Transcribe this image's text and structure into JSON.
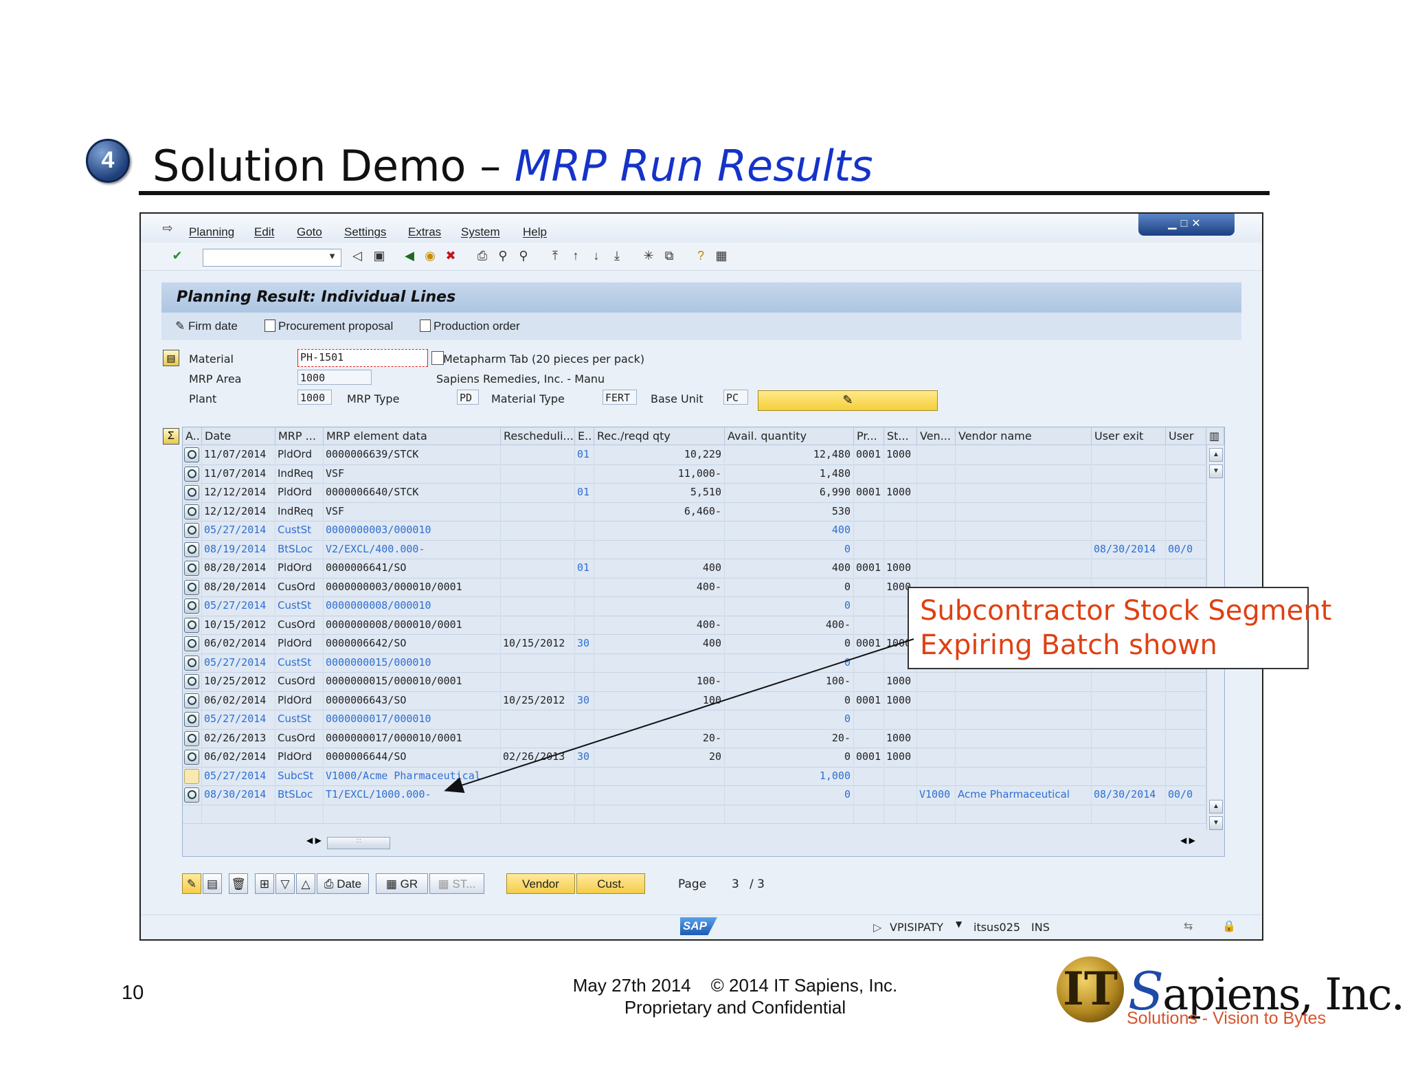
{
  "slide": {
    "step_number": "4",
    "title_main": "Solution Demo – ",
    "title_sub": "MRP Run Results",
    "page_number": "10",
    "footer_line1": "May 27th 2014    © 2014 IT Sapiens, Inc.",
    "footer_line2": "Proprietary and Confidential",
    "logo_mark": "IT",
    "logo_s": "S",
    "logo_rest": "apiens, Inc.",
    "logo_tagline": "Solutions - Vision to Bytes"
  },
  "callout": {
    "line1": "Subcontractor Stock Segment",
    "line2": "Expiring Batch shown",
    "color": "#e04012"
  },
  "sap": {
    "menu": [
      "Planning",
      "Edit",
      "Goto",
      "Settings",
      "Extras",
      "System",
      "Help"
    ],
    "screen_title": "Planning Result: Individual Lines",
    "app_toolbar": [
      "Firm date",
      "Procurement proposal",
      "Production order"
    ],
    "header_fields": {
      "material_label": "Material",
      "material_value": "PH-1501",
      "material_desc": "Metapharm Tab (20 pieces per pack)",
      "mrp_area_label": "MRP Area",
      "mrp_area_value": "1000",
      "mrp_area_desc": "Sapiens Remedies, Inc. - Manu",
      "plant_label": "Plant",
      "plant_value": "1000",
      "mrp_type_label": "MRP Type",
      "mrp_type_value": "PD",
      "material_type_label": "Material Type",
      "material_type_value": "FERT",
      "base_unit_label": "Base Unit",
      "base_unit_value": "PC"
    },
    "columns": [
      "A..",
      "Date",
      "MRP ...",
      "MRP element data",
      "Rescheduli...",
      "E..",
      "Rec./reqd qty",
      "Avail. quantity",
      "Pr...",
      "St...",
      "Ven...",
      "Vendor name",
      "User exit",
      "User"
    ],
    "rows": [
      {
        "date": "11/07/2014",
        "mrp": "PldOrd",
        "data": "0000006639/STCK",
        "resched": "",
        "e": "01",
        "qty": "10,229",
        "avail": "12,480",
        "pr": "0001",
        "st": "1000",
        "ven": "",
        "vname": "",
        "uexit": "",
        "user": "",
        "style": "normal"
      },
      {
        "date": "11/07/2014",
        "mrp": "IndReq",
        "data": "VSF",
        "resched": "",
        "e": "",
        "qty": "11,000-",
        "avail": "1,480",
        "pr": "",
        "st": "",
        "ven": "",
        "vname": "",
        "uexit": "",
        "user": "",
        "style": "normal"
      },
      {
        "date": "12/12/2014",
        "mrp": "PldOrd",
        "data": "0000006640/STCK",
        "resched": "",
        "e": "01",
        "qty": "5,510",
        "avail": "6,990",
        "pr": "0001",
        "st": "1000",
        "ven": "",
        "vname": "",
        "uexit": "",
        "user": "",
        "style": "normal"
      },
      {
        "date": "12/12/2014",
        "mrp": "IndReq",
        "data": "VSF",
        "resched": "",
        "e": "",
        "qty": "6,460-",
        "avail": "530",
        "pr": "",
        "st": "",
        "ven": "",
        "vname": "",
        "uexit": "",
        "user": "",
        "style": "normal"
      },
      {
        "date": "05/27/2014",
        "mrp": "CustSt",
        "data": "0000000003/000010",
        "resched": "",
        "e": "",
        "qty": "",
        "avail": "400",
        "pr": "",
        "st": "",
        "ven": "",
        "vname": "",
        "uexit": "",
        "user": "",
        "style": "blue"
      },
      {
        "date": "08/19/2014",
        "mrp": "BtSLoc",
        "data": "V2/EXCL/400.000-",
        "resched": "",
        "e": "",
        "qty": "",
        "avail": "0",
        "pr": "",
        "st": "",
        "ven": "",
        "vname": "",
        "uexit": "08/30/2014",
        "user": "00/0",
        "style": "blue"
      },
      {
        "date": "08/20/2014",
        "mrp": "PldOrd",
        "data": "0000006641/SO",
        "resched": "",
        "e": "01",
        "qty": "400",
        "avail": "400",
        "pr": "0001",
        "st": "1000",
        "ven": "",
        "vname": "",
        "uexit": "",
        "user": "",
        "style": "normal"
      },
      {
        "date": "08/20/2014",
        "mrp": "CusOrd",
        "data": "0000000003/000010/0001",
        "resched": "",
        "e": "",
        "qty": "400-",
        "avail": "0",
        "pr": "",
        "st": "1000",
        "ven": "",
        "vname": "",
        "uexit": "",
        "user": "",
        "style": "normal"
      },
      {
        "date": "05/27/2014",
        "mrp": "CustSt",
        "data": "0000000008/000010",
        "resched": "",
        "e": "",
        "qty": "",
        "avail": "0",
        "pr": "",
        "st": "",
        "ven": "",
        "vname": "",
        "uexit": "",
        "user": "",
        "style": "blue"
      },
      {
        "date": "10/15/2012",
        "mrp": "CusOrd",
        "data": "0000000008/000010/0001",
        "resched": "",
        "e": "",
        "qty": "400-",
        "avail": "400-",
        "pr": "",
        "st": "",
        "ven": "",
        "vname": "",
        "uexit": "",
        "user": "",
        "style": "normal"
      },
      {
        "date": "06/02/2014",
        "mrp": "PldOrd",
        "data": "0000006642/SO",
        "resched": "10/15/2012",
        "e": "30",
        "qty": "400",
        "avail": "0",
        "pr": "0001",
        "st": "1000",
        "ven": "",
        "vname": "",
        "uexit": "",
        "user": "",
        "style": "normal"
      },
      {
        "date": "05/27/2014",
        "mrp": "CustSt",
        "data": "0000000015/000010",
        "resched": "",
        "e": "",
        "qty": "",
        "avail": "0",
        "pr": "",
        "st": "",
        "ven": "",
        "vname": "",
        "uexit": "",
        "user": "",
        "style": "blue"
      },
      {
        "date": "10/25/2012",
        "mrp": "CusOrd",
        "data": "0000000015/000010/0001",
        "resched": "",
        "e": "",
        "qty": "100-",
        "avail": "100-",
        "pr": "",
        "st": "1000",
        "ven": "",
        "vname": "",
        "uexit": "",
        "user": "",
        "style": "normal"
      },
      {
        "date": "06/02/2014",
        "mrp": "PldOrd",
        "data": "0000006643/SO",
        "resched": "10/25/2012",
        "e": "30",
        "qty": "100",
        "avail": "0",
        "pr": "0001",
        "st": "1000",
        "ven": "",
        "vname": "",
        "uexit": "",
        "user": "",
        "style": "normal"
      },
      {
        "date": "05/27/2014",
        "mrp": "CustSt",
        "data": "0000000017/000010",
        "resched": "",
        "e": "",
        "qty": "",
        "avail": "0",
        "pr": "",
        "st": "",
        "ven": "",
        "vname": "",
        "uexit": "",
        "user": "",
        "style": "blue"
      },
      {
        "date": "02/26/2013",
        "mrp": "CusOrd",
        "data": "0000000017/000010/0001",
        "resched": "",
        "e": "",
        "qty": "20-",
        "avail": "20-",
        "pr": "",
        "st": "1000",
        "ven": "",
        "vname": "",
        "uexit": "",
        "user": "",
        "style": "normal"
      },
      {
        "date": "06/02/2014",
        "mrp": "PldOrd",
        "data": "0000006644/SO",
        "resched": "02/26/2013",
        "e": "30",
        "qty": "20",
        "avail": "0",
        "pr": "0001",
        "st": "1000",
        "ven": "",
        "vname": "",
        "uexit": "",
        "user": "",
        "style": "normal"
      },
      {
        "date": "05/27/2014",
        "mrp": "SubcSt",
        "data": "V1000/Acme Pharmaceutical",
        "resched": "",
        "e": "",
        "qty": "",
        "avail": "1,000",
        "pr": "",
        "st": "",
        "ven": "",
        "vname": "",
        "uexit": "",
        "user": "",
        "style": "blue",
        "icon": "blank"
      },
      {
        "date": "08/30/2014",
        "mrp": "BtSLoc",
        "data": "T1/EXCL/1000.000-",
        "resched": "",
        "e": "",
        "qty": "",
        "avail": "0",
        "pr": "",
        "st": "",
        "ven": "V1000",
        "vname": "Acme Pharmaceutical",
        "uexit": "08/30/2014",
        "user": "00/0",
        "style": "blue"
      }
    ],
    "bottom_buttons": {
      "date": "Date",
      "gr": "GR",
      "st": "ST...",
      "vendor": "Vendor",
      "cust": "Cust."
    },
    "page_label": "Page",
    "page_current": "3",
    "page_total": "/  3",
    "status": {
      "sap_logo": "SAP",
      "system": "VPISIPATY",
      "server": "itsus025",
      "mode": "INS"
    }
  }
}
